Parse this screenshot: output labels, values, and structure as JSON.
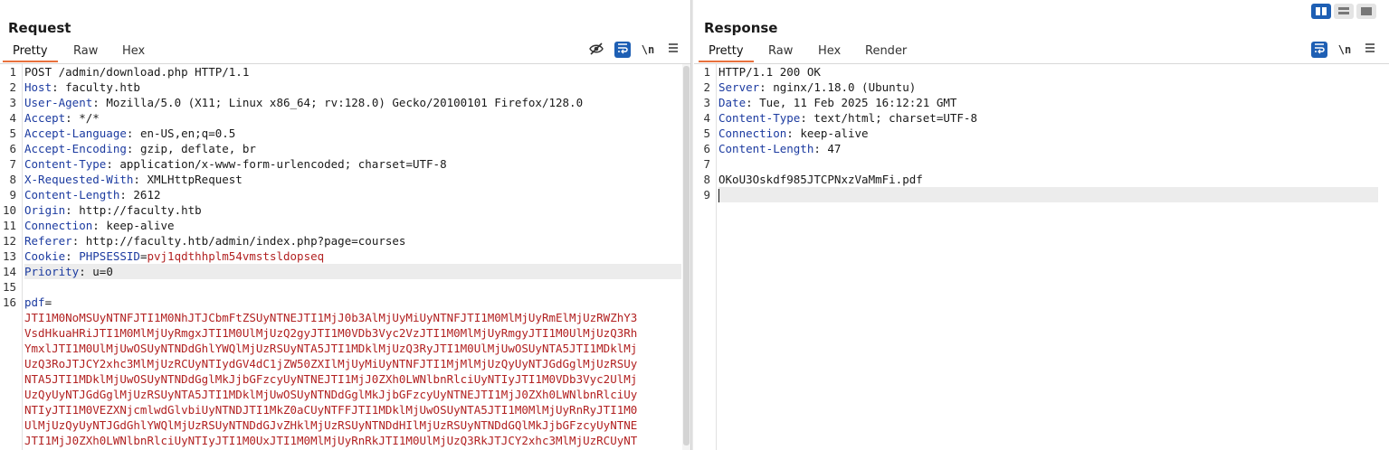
{
  "request": {
    "title": "Request",
    "tabs": [
      "Pretty",
      "Raw",
      "Hex"
    ],
    "active_tab": "Pretty",
    "tool_icons": [
      "hide-eye-icon",
      "word-wrap-icon",
      "newline-icon",
      "menu-icon"
    ],
    "newline_label": "\\n",
    "lines": [
      {
        "n": "1",
        "parts": [
          {
            "t": "POST /admin/download.php HTTP/1.1",
            "c": "v"
          }
        ]
      },
      {
        "n": "2",
        "parts": [
          {
            "t": "Host",
            "c": "k"
          },
          {
            "t": ": faculty.htb",
            "c": "v"
          }
        ]
      },
      {
        "n": "3",
        "parts": [
          {
            "t": "User-Agent",
            "c": "k"
          },
          {
            "t": ": Mozilla/5.0 (X11; Linux x86_64; rv:128.0) Gecko/20100101 Firefox/128.0",
            "c": "v"
          }
        ]
      },
      {
        "n": "4",
        "parts": [
          {
            "t": "Accept",
            "c": "k"
          },
          {
            "t": ": */*",
            "c": "v"
          }
        ]
      },
      {
        "n": "5",
        "parts": [
          {
            "t": "Accept-Language",
            "c": "k"
          },
          {
            "t": ": en-US,en;q=0.5",
            "c": "v"
          }
        ]
      },
      {
        "n": "6",
        "parts": [
          {
            "t": "Accept-Encoding",
            "c": "k"
          },
          {
            "t": ": gzip, deflate, br",
            "c": "v"
          }
        ]
      },
      {
        "n": "7",
        "parts": [
          {
            "t": "Content-Type",
            "c": "k"
          },
          {
            "t": ": application/x-www-form-urlencoded; charset=UTF-8",
            "c": "v"
          }
        ]
      },
      {
        "n": "8",
        "parts": [
          {
            "t": "X-Requested-With",
            "c": "k"
          },
          {
            "t": ": XMLHttpRequest",
            "c": "v"
          }
        ]
      },
      {
        "n": "9",
        "parts": [
          {
            "t": "Content-Length",
            "c": "k"
          },
          {
            "t": ": 2612",
            "c": "v"
          }
        ]
      },
      {
        "n": "10",
        "parts": [
          {
            "t": "Origin",
            "c": "k"
          },
          {
            "t": ": http://faculty.htb",
            "c": "v"
          }
        ]
      },
      {
        "n": "11",
        "parts": [
          {
            "t": "Connection",
            "c": "k"
          },
          {
            "t": ": keep-alive",
            "c": "v"
          }
        ]
      },
      {
        "n": "12",
        "parts": [
          {
            "t": "Referer",
            "c": "k"
          },
          {
            "t": ": http://faculty.htb/admin/index.php?page=courses",
            "c": "v"
          }
        ]
      },
      {
        "n": "13",
        "parts": [
          {
            "t": "Cookie",
            "c": "k"
          },
          {
            "t": ": ",
            "c": "v"
          },
          {
            "t": "PHPSESSID",
            "c": "ck"
          },
          {
            "t": "=",
            "c": "v"
          },
          {
            "t": "pvj1qdthhplm54vmstsldopseq",
            "c": "cv"
          }
        ]
      },
      {
        "n": "14",
        "parts": [
          {
            "t": "Priority",
            "c": "k"
          },
          {
            "t": ": u=0",
            "c": "v"
          }
        ],
        "highlight": true
      },
      {
        "n": "15",
        "parts": [
          {
            "t": "",
            "c": "v"
          }
        ]
      },
      {
        "n": "16",
        "parts": [
          {
            "t": "pdf",
            "c": "body-key"
          },
          {
            "t": "=",
            "c": "v"
          }
        ]
      },
      {
        "n": "",
        "parts": [
          {
            "t": "JTI1M0NoMSUyNTNFJTI1M0NhJTJCbmFtZSUyNTNEJTI1MjJ0b3AlMjUyMiUyNTNFJTI1M0MlMjUyRmElMjUzRWZhY3",
            "c": "red"
          }
        ]
      },
      {
        "n": "",
        "parts": [
          {
            "t": "VsdHkuaHRiJTI1M0MlMjUyRmgxJTI1M0UlMjUzQ2gyJTI1M0VDb3Vyc2VzJTI1M0MlMjUyRmgyJTI1M0UlMjUzQ3Rh",
            "c": "red"
          }
        ]
      },
      {
        "n": "",
        "parts": [
          {
            "t": "YmxlJTI1M0UlMjUwOSUyNTNDdGhlYWQlMjUzRSUyNTA5JTI1MDklMjUzQ3RyJTI1M0UlMjUwOSUyNTA5JTI1MDklMj",
            "c": "red"
          }
        ]
      },
      {
        "n": "",
        "parts": [
          {
            "t": "UzQ3RoJTJCY2xhc3MlMjUzRCUyNTIydGV4dC1jZW50ZXIlMjUyMiUyNTNFJTI1MjMlMjUzQyUyNTJGdGglMjUzRSUy",
            "c": "red"
          }
        ]
      },
      {
        "n": "",
        "parts": [
          {
            "t": "NTA5JTI1MDklMjUwOSUyNTNDdGglMkJjbGFzcyUyNTNEJTI1MjJ0ZXh0LWNlbnRlciUyNTIyJTI1M0VDb3Vyc2UlMj",
            "c": "red"
          }
        ]
      },
      {
        "n": "",
        "parts": [
          {
            "t": "UzQyUyNTJGdGglMjUzRSUyNTA5JTI1MDklMjUwOSUyNTNDdGglMkJjbGFzcyUyNTNEJTI1MjJ0ZXh0LWNlbnRlciUy",
            "c": "red"
          }
        ]
      },
      {
        "n": "",
        "parts": [
          {
            "t": "NTIyJTI1M0VEZXNjcmlwdGlvbiUyNTNDJTI1MkZ0aCUyNTFFJTI1MDklMjUwOSUyNTA5JTI1M0MlMjUyRnRyJTI1M0",
            "c": "red"
          }
        ]
      },
      {
        "n": "",
        "parts": [
          {
            "t": "UlMjUzQyUyNTJGdGhlYWQlMjUzRSUyNTNDdGJvZHklMjUzRSUyNTNDdHIlMjUzRSUyNTNDdGQlMkJjbGFzcyUyNTNE",
            "c": "red"
          }
        ]
      },
      {
        "n": "",
        "parts": [
          {
            "t": "JTI1MjJ0ZXh0LWNlbnRlciUyNTIyJTI1M0UxJTI1M0MlMjUyRnRkJTI1M0UlMjUzQ3RkJTJCY2xhc3MlMjUzRCUyNT",
            "c": "red"
          }
        ]
      }
    ]
  },
  "response": {
    "title": "Response",
    "tabs": [
      "Pretty",
      "Raw",
      "Hex",
      "Render"
    ],
    "active_tab": "Pretty",
    "tool_icons": [
      "word-wrap-icon",
      "newline-icon",
      "menu-icon"
    ],
    "newline_label": "\\n",
    "lines": [
      {
        "n": "1",
        "parts": [
          {
            "t": "HTTP/1.1 200 OK",
            "c": "v"
          }
        ]
      },
      {
        "n": "2",
        "parts": [
          {
            "t": "Server",
            "c": "k"
          },
          {
            "t": ": nginx/1.18.0 (Ubuntu)",
            "c": "v"
          }
        ]
      },
      {
        "n": "3",
        "parts": [
          {
            "t": "Date",
            "c": "k"
          },
          {
            "t": ": Tue, 11 Feb 2025 16:12:21 GMT",
            "c": "v"
          }
        ]
      },
      {
        "n": "4",
        "parts": [
          {
            "t": "Content-Type",
            "c": "k"
          },
          {
            "t": ": text/html; charset=UTF-8",
            "c": "v"
          }
        ]
      },
      {
        "n": "5",
        "parts": [
          {
            "t": "Connection",
            "c": "k"
          },
          {
            "t": ": keep-alive",
            "c": "v"
          }
        ]
      },
      {
        "n": "6",
        "parts": [
          {
            "t": "Content-Length",
            "c": "k"
          },
          {
            "t": ": 47",
            "c": "v"
          }
        ]
      },
      {
        "n": "7",
        "parts": [
          {
            "t": "",
            "c": "v"
          }
        ]
      },
      {
        "n": "8",
        "parts": [
          {
            "t": "OKoU3Oskdf985JTCPNxzVaMmFi.pdf",
            "c": "v"
          }
        ]
      },
      {
        "n": "9",
        "parts": [
          {
            "t": "",
            "c": "v"
          }
        ],
        "highlight": true,
        "caret": true
      }
    ]
  },
  "layout_buttons": [
    "split-vertical-icon",
    "split-horizontal-icon",
    "single-pane-icon"
  ]
}
